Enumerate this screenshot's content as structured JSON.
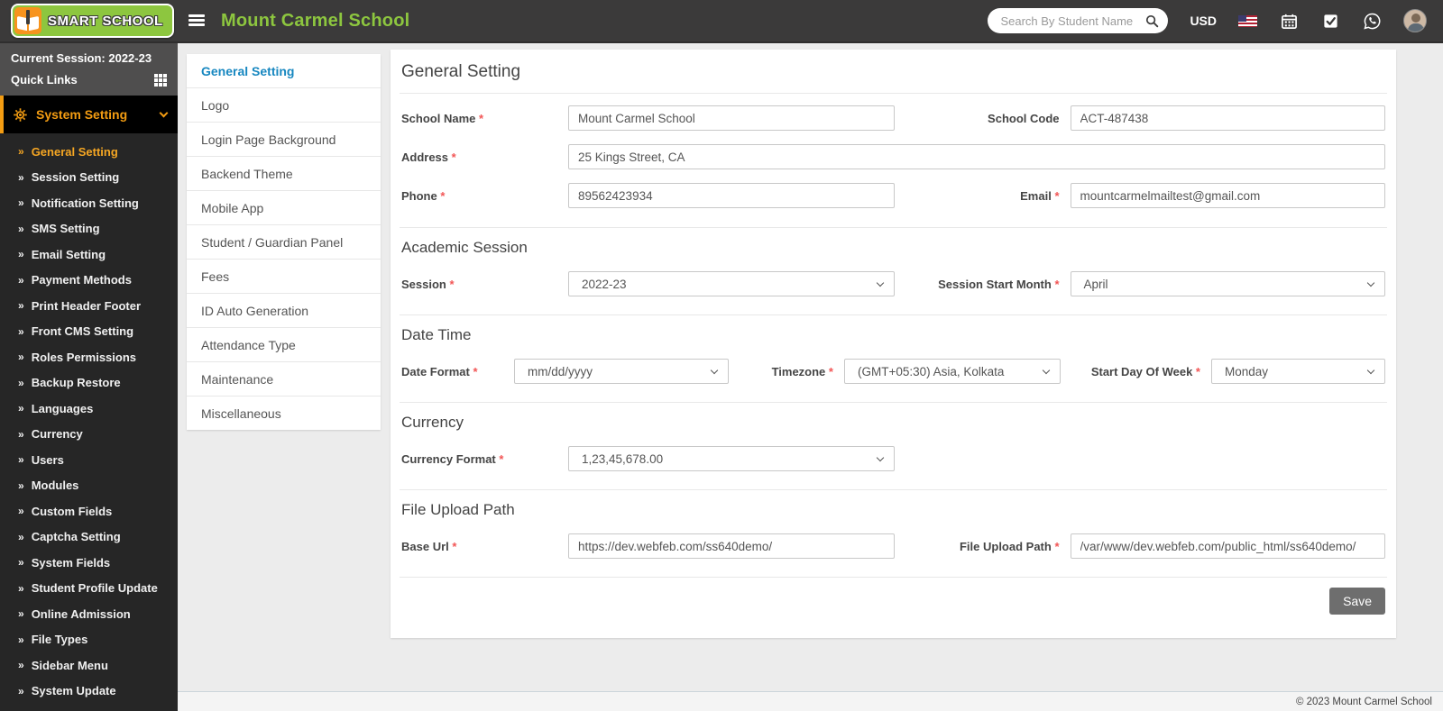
{
  "header": {
    "brand": "SMART SCHOOL",
    "school_name": "Mount Carmel School",
    "search_placeholder": "Search By Student Name",
    "currency": "USD"
  },
  "sidebar": {
    "current_session": "Current Session: 2022-23",
    "quick_links": "Quick Links",
    "menu_header": "System Setting",
    "items": [
      {
        "label": "General Setting",
        "active": true
      },
      {
        "label": "Session Setting"
      },
      {
        "label": "Notification Setting"
      },
      {
        "label": "SMS Setting"
      },
      {
        "label": "Email Setting"
      },
      {
        "label": "Payment Methods"
      },
      {
        "label": "Print Header Footer"
      },
      {
        "label": "Front CMS Setting"
      },
      {
        "label": "Roles Permissions"
      },
      {
        "label": "Backup Restore"
      },
      {
        "label": "Languages"
      },
      {
        "label": "Currency"
      },
      {
        "label": "Users"
      },
      {
        "label": "Modules"
      },
      {
        "label": "Custom Fields"
      },
      {
        "label": "Captcha Setting"
      },
      {
        "label": "System Fields"
      },
      {
        "label": "Student Profile Update"
      },
      {
        "label": "Online Admission"
      },
      {
        "label": "File Types"
      },
      {
        "label": "Sidebar Menu"
      },
      {
        "label": "System Update"
      }
    ]
  },
  "tabs": {
    "items": [
      {
        "label": "General Setting",
        "active": true
      },
      {
        "label": "Logo"
      },
      {
        "label": "Login Page Background"
      },
      {
        "label": "Backend Theme"
      },
      {
        "label": "Mobile App"
      },
      {
        "label": "Student / Guardian Panel"
      },
      {
        "label": "Fees"
      },
      {
        "label": "ID Auto Generation"
      },
      {
        "label": "Attendance Type"
      },
      {
        "label": "Maintenance"
      },
      {
        "label": "Miscellaneous"
      }
    ]
  },
  "form": {
    "title": "General Setting",
    "school_name": {
      "label": "School Name",
      "value": "Mount Carmel School"
    },
    "school_code": {
      "label": "School Code",
      "value": "ACT-487438"
    },
    "address": {
      "label": "Address",
      "value": "25 Kings Street, CA"
    },
    "phone": {
      "label": "Phone",
      "value": "89562423934"
    },
    "email": {
      "label": "Email",
      "value": "mountcarmelmailtest@gmail.com"
    },
    "academic_session": {
      "heading": "Academic Session",
      "session": {
        "label": "Session",
        "value": "2022-23"
      },
      "start_month": {
        "label": "Session Start Month",
        "value": "April"
      }
    },
    "date_time": {
      "heading": "Date Time",
      "date_format": {
        "label": "Date Format",
        "value": "mm/dd/yyyy"
      },
      "timezone": {
        "label": "Timezone",
        "value": "(GMT+05:30) Asia, Kolkata"
      },
      "start_day": {
        "label": "Start Day Of Week",
        "value": "Monday"
      }
    },
    "currency": {
      "heading": "Currency",
      "currency_format": {
        "label": "Currency Format",
        "value": "1,23,45,678.00"
      }
    },
    "file_upload": {
      "heading": "File Upload Path",
      "base_url": {
        "label": "Base Url",
        "value": "https://dev.webfeb.com/ss640demo/"
      },
      "upload_path": {
        "label": "File Upload Path",
        "value": "/var/www/dev.webfeb.com/public_html/ss640demo/"
      }
    },
    "save_label": "Save"
  },
  "footer": {
    "copyright": "© 2023 Mount Carmel School"
  }
}
